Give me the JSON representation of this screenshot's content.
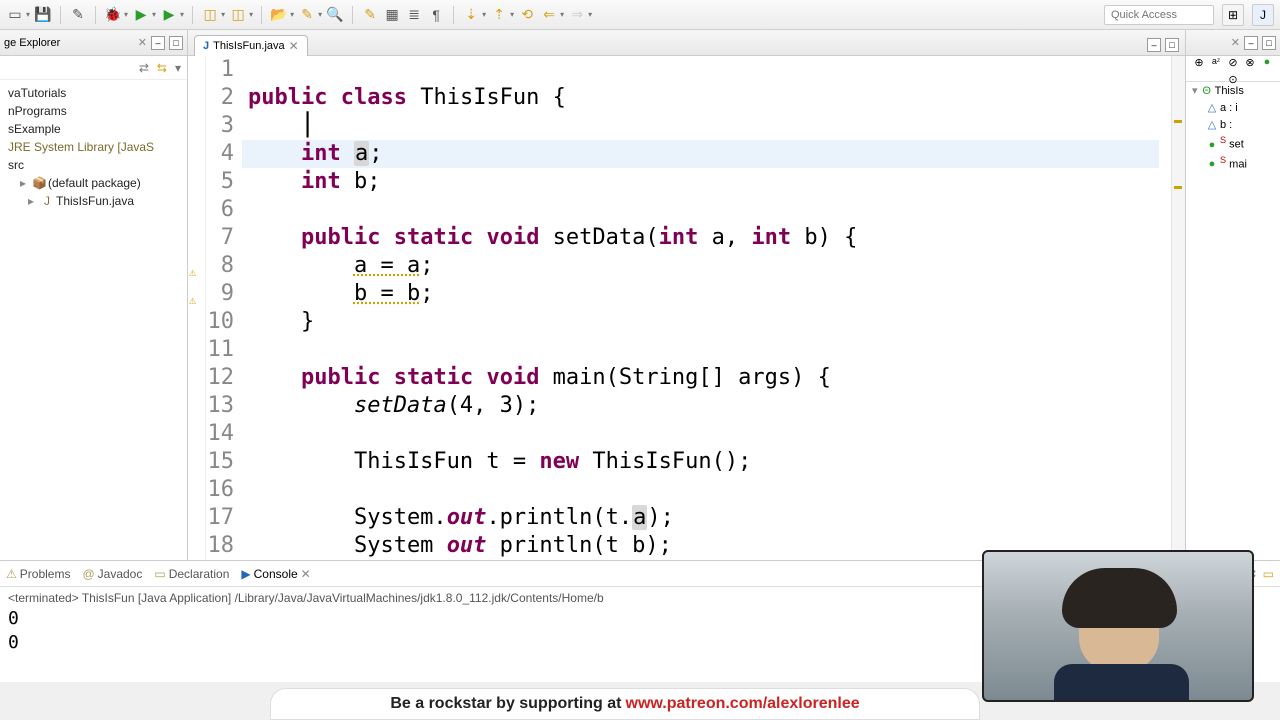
{
  "toolbar": {
    "quick_access_placeholder": "Quick Access"
  },
  "explorer": {
    "title": "ge Explorer",
    "close_icon": "✕",
    "items": [
      {
        "label": "vaTutorials",
        "indent": 0,
        "icon": ""
      },
      {
        "label": "nPrograms",
        "indent": 0,
        "icon": ""
      },
      {
        "label": "sExample",
        "indent": 0,
        "icon": ""
      },
      {
        "label": "JRE System Library [JavaS",
        "indent": 0,
        "icon": "",
        "cls": "lib"
      },
      {
        "label": "src",
        "indent": 0,
        "icon": ""
      },
      {
        "label": "(default package)",
        "indent": 1,
        "icon": "📦",
        "caret": "▸"
      },
      {
        "label": "ThisIsFun.java",
        "indent": 2,
        "icon": "J",
        "caret": "▸"
      }
    ]
  },
  "editor": {
    "tab_label": "ThisIsFun.java",
    "highlighted_line": 4,
    "code_tokens": [
      [],
      [
        [
          "kw",
          "public"
        ],
        [
          "",
          " "
        ],
        [
          "kw",
          "class"
        ],
        [
          "",
          " ThisIsFun {"
        ]
      ],
      [
        [
          "",
          "    "
        ],
        [
          "cursor",
          "⎮"
        ]
      ],
      [
        [
          "",
          "    "
        ],
        [
          "kw",
          "int"
        ],
        [
          "",
          " "
        ],
        [
          "occ",
          "a"
        ],
        [
          "",
          ";"
        ]
      ],
      [
        [
          "",
          "    "
        ],
        [
          "kw",
          "int"
        ],
        [
          "",
          " b;"
        ]
      ],
      [],
      [
        [
          "",
          "    "
        ],
        [
          "kw",
          "public"
        ],
        [
          "",
          " "
        ],
        [
          "kw",
          "static"
        ],
        [
          "",
          " "
        ],
        [
          "kw",
          "void"
        ],
        [
          "",
          " setData("
        ],
        [
          "kw",
          "int"
        ],
        [
          "",
          " a, "
        ],
        [
          "kw",
          "int"
        ],
        [
          "",
          " b) {"
        ]
      ],
      [
        [
          "",
          "        "
        ],
        [
          "warn",
          "a = a"
        ],
        [
          "",
          ";"
        ]
      ],
      [
        [
          "",
          "        "
        ],
        [
          "warn",
          "b = b"
        ],
        [
          "",
          ";"
        ]
      ],
      [
        [
          "",
          "    }"
        ]
      ],
      [],
      [
        [
          "",
          "    "
        ],
        [
          "kw",
          "public"
        ],
        [
          "",
          " "
        ],
        [
          "kw",
          "static"
        ],
        [
          "",
          " "
        ],
        [
          "kw",
          "void"
        ],
        [
          "",
          " main(String[] args) {"
        ]
      ],
      [
        [
          "",
          "        "
        ],
        [
          "it",
          "setData"
        ],
        [
          "",
          "(4, 3);"
        ]
      ],
      [],
      [
        [
          "",
          "        ThisIsFun t = "
        ],
        [
          "kw",
          "new"
        ],
        [
          "",
          " ThisIsFun();"
        ]
      ],
      [],
      [
        [
          "",
          "        System."
        ],
        [
          "kw it",
          "out"
        ],
        [
          "",
          ".println(t."
        ],
        [
          "occ",
          "a"
        ],
        [
          "",
          ");"
        ]
      ],
      [
        [
          "",
          "        System "
        ],
        [
          "kw it",
          "out"
        ],
        [
          "",
          " println(t b);"
        ]
      ]
    ],
    "line_count": 18
  },
  "outline": {
    "root": "ThisIs",
    "items": [
      {
        "label": "a : i",
        "icon": "△",
        "color": "#3a72c8"
      },
      {
        "label": "b :",
        "icon": "△",
        "color": "#3a72c8"
      },
      {
        "label": "set",
        "icon": "●",
        "color": "#2a9d2a",
        "sup": "S"
      },
      {
        "label": "mai",
        "icon": "●",
        "color": "#2a9d2a",
        "sup": "S"
      }
    ]
  },
  "console": {
    "tabs": [
      "Problems",
      "Javadoc",
      "Declaration",
      "Console"
    ],
    "active": 3,
    "status": "<terminated> ThisIsFun [Java Application] /Library/Java/JavaVirtualMachines/jdk1.8.0_112.jdk/Contents/Home/b",
    "output": [
      "0",
      "0"
    ]
  },
  "banner": {
    "pre": "Be a rockstar by supporting at ",
    "link": "www.patreon.com/alexlorenlee"
  }
}
